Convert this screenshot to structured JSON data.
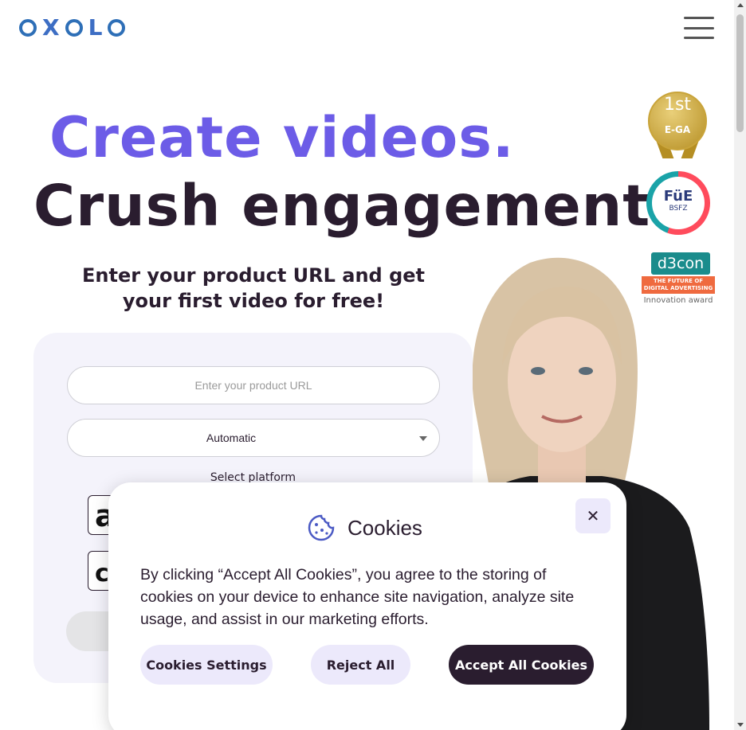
{
  "header": {
    "logo_text": "OXOLO",
    "logo_letters": [
      "X",
      "L"
    ]
  },
  "hero": {
    "headline_1": "Create videos.",
    "headline_2": "Crush engagement.",
    "subtitle": "Enter your product URL and get your first video for free!"
  },
  "badges": {
    "ega": {
      "rank": "1st",
      "label": "E-GA"
    },
    "fue": {
      "label": "FüE",
      "sub": "BSFZ"
    },
    "d3con": {
      "label": "d3con",
      "strip": "THE FUTURE OF DIGITAL ADVERTISING",
      "award": "Innovation award"
    }
  },
  "form": {
    "url_placeholder": "Enter your product URL",
    "select_value": "Automatic",
    "platform_label": "Select platform"
  },
  "cookie_banner": {
    "title": "Cookies",
    "body": "By clicking “Accept All Cookies”, you agree to the storing of cookies on your device to enhance site navigation, analyze site usage, and assist in our marketing efforts.",
    "settings_label": "Cookies Settings",
    "reject_label": "Reject All",
    "accept_label": "Accept All Cookies",
    "close_symbol": "✕"
  },
  "colors": {
    "accent_violet": "#6c5ce7",
    "dark": "#2a1d2f",
    "panel_bg": "#f4f3fb",
    "button_light": "#ece9fb"
  },
  "icons": [
    "hamburger-menu-icon",
    "cookie-icon",
    "close-icon",
    "amazon-icon",
    "shopify-icon"
  ]
}
